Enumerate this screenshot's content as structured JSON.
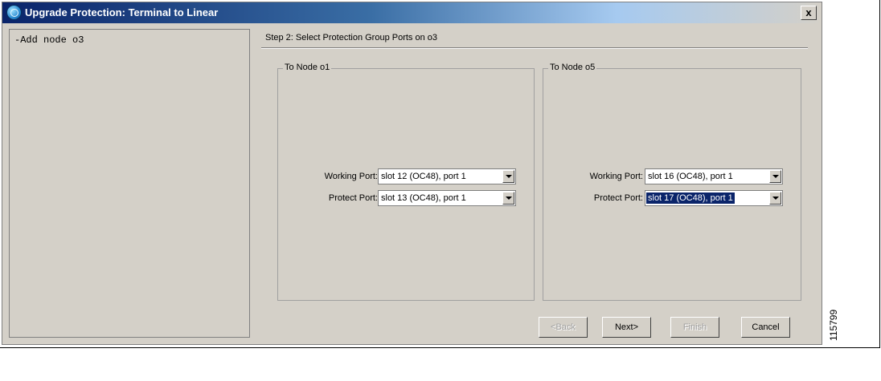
{
  "window": {
    "title": "Upgrade Protection: Terminal to Linear",
    "close_label": "x"
  },
  "left_pane": {
    "items": [
      "-Add node o3"
    ]
  },
  "step": {
    "title": "Step 2: Select Protection Group Ports on o3"
  },
  "groups": [
    {
      "legend": "To Node o1",
      "working_label": "Working Port:",
      "working_value": "slot 12 (OC48), port 1",
      "protect_label": "Protect Port:",
      "protect_value": "slot 13 (OC48), port 1"
    },
    {
      "legend": "To Node o5",
      "working_label": "Working Port:",
      "working_value": "slot 16 (OC48), port 1",
      "protect_label": "Protect Port:",
      "protect_value": "slot 17 (OC48), port 1"
    }
  ],
  "buttons": {
    "back": "<Back",
    "next": "Next>",
    "finish": "Finish",
    "cancel": "Cancel"
  },
  "figure_id": "115799",
  "colors": {
    "title_bar_start": "#0a246a",
    "dialog_bg": "#d4d0c8",
    "selection": "#0a246a"
  }
}
